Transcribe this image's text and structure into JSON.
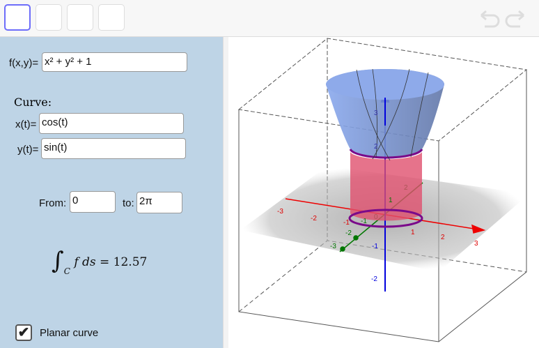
{
  "toolbar": {
    "undo_icon": "undo-icon",
    "redo_icon": "redo-icon"
  },
  "inputs": {
    "f_label": "f(x,y)=",
    "f_value": "x² + y² + 1",
    "curve_heading": "Curve:",
    "x_label": "x(t)=",
    "x_value": "cos(t)",
    "y_label": "y(t)=",
    "y_value": "sin(t)",
    "from_label": "From:",
    "from_value": "0",
    "to_label": "to:",
    "to_value": "2π"
  },
  "result": {
    "integral_symbol": "∫",
    "subscript": "C",
    "integrand": "f ds =",
    "value": "12.57"
  },
  "planar": {
    "label": "Planar curve",
    "checked": true,
    "check_mark": "✔"
  },
  "axes": {
    "x_ticks": [
      "-3",
      "-2",
      "-1",
      "1",
      "2",
      "3"
    ],
    "y_ticks": [
      "-3",
      "-2",
      "-1",
      "1",
      "2"
    ],
    "z_ticks": [
      "-2",
      "-1",
      "2",
      "3"
    ],
    "origin": "0",
    "colors": {
      "x": "#e00000",
      "y": "#007700",
      "z": "#0000dd",
      "surface": "#6f94e0",
      "cylinder": "#e0506e",
      "curve": "#7a0a8a"
    }
  }
}
